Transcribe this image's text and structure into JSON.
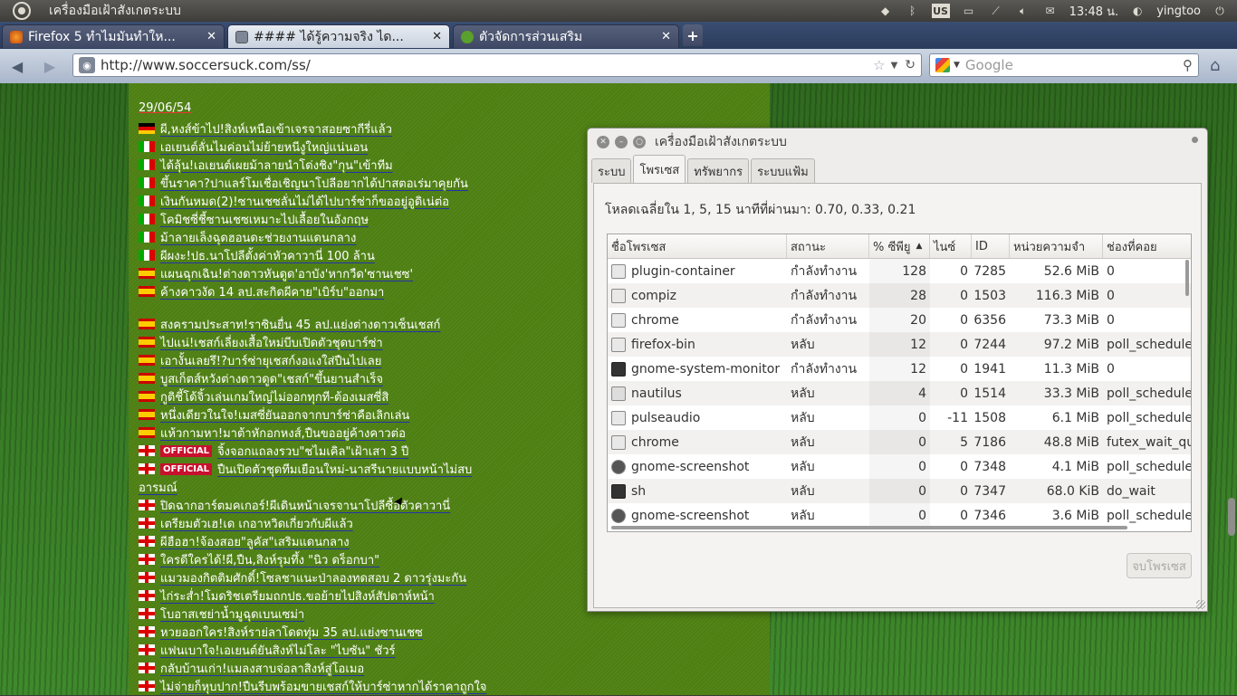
{
  "top_panel": {
    "app_title": "เครื่องมือเฝ้าสังเกตระบบ",
    "keyboard_layout": "US",
    "clock": "13:48 น.",
    "user": "yingtoo"
  },
  "tabs": [
    {
      "label": "Firefox 5 ทำไมมันทำให...",
      "icon": "firefox-icon"
    },
    {
      "label": "#### ได้รู้ความจริง ได...",
      "icon": "page-icon"
    },
    {
      "label": "ตัวจัดการส่วนเสริม",
      "icon": "puzzle-icon"
    }
  ],
  "nav": {
    "url": "http://www.soccersuck.com/ss/",
    "search_placeholder": "Google"
  },
  "news": {
    "date": "29/06/54",
    "items": [
      {
        "flag": "de",
        "text": "ผี,หงส์ข้าไป!สิงห์เหนือเข้าเจรจาสอยซากีรี่แล้ว"
      },
      {
        "flag": "it",
        "text": "เอเยนต์ลั่นไมค่อนไม่ย้ายหนีงูใหญ่แน่นอน"
      },
      {
        "flag": "it",
        "text": "ได้ลุ้น!เอเยนต์เผยม้าลายนำโด่งชิง\"กุน\"เข้าทีม"
      },
      {
        "flag": "it",
        "text": "ขึ้นราคา?ปาแลร์โมเชื่อเชิญนาโปลีอยากได้ปาสตอเร่มาคุยกัน"
      },
      {
        "flag": "it",
        "text": "เงินกันหมด(2)!ซานเชซลั่นไม่ได้ไปบาร์ซ่าก็ขออยู่อูดิเน่ต่อ"
      },
      {
        "flag": "it",
        "text": "โคมิชซี่ชี้ซานเชซเหมาะไปเลื้อยในอังกฤษ"
      },
      {
        "flag": "it",
        "text": "ม้าลายเล็งฉุดฮอนดะช่วยงานแดนกลาง"
      },
      {
        "flag": "it",
        "text": "ผีผงะ!ปธ.นาโปลีตั้งค่าหัวคาวานี่ 100 ล้าน"
      },
      {
        "flag": "es",
        "text": "แผนฉุกเฉิน!ต่างดาวหันดูด'อาบัง'หากวืด'ซานเชซ'"
      },
      {
        "flag": "es",
        "text": "ค้างคาวงัด 14 ลป.สะกิดผีคาย\"เบิร์บ\"ออกมา"
      },
      {
        "flag": "es",
        "text": "สงครามประสาท!ราซินยื่น 45 ลป.แย่งต่างดาวเซ็นเชสก์"
      },
      {
        "flag": "es",
        "text": "ไปแน่!เชสก์เลี่ยงเสื้อใหม่บีบเปิดตัวชุดบาร์ซ่า"
      },
      {
        "flag": "es",
        "text": "เอางั้นเลยรึ!?บาร์ซ่ายุเชสก์งอแงใส่ปืนไปเลย"
      },
      {
        "flag": "es",
        "text": "บูสเก็ตส์หวังต่างดาวดูด\"เชสก์\"ขึ้นยานสำเร็จ"
      },
      {
        "flag": "es",
        "text": "กูติชี้โด้จิ้วเล่นเกมใหญ่ไม่ออกทุกที-ต้องเมสซี่สิ"
      },
      {
        "flag": "es",
        "text": "หนึ่งเดียวในใจ!เมสซี่ยันออกจากบาร์ซ่าคือเลิกเล่น"
      },
      {
        "flag": "es",
        "text": "แห้วกามหา!มาต้าหักอกหงส์,ปืนขออยู่ค้างคาวต่อ"
      },
      {
        "flag": "en",
        "official": "OFFICIAL",
        "text": "จิ้งจอกแถลงรวบ\"ชไมเคิล\"เฝ้าเสา 3 ปี"
      },
      {
        "flag": "en",
        "official": "OFFICIAL",
        "text": "ปืนเปิดตัวชุดทีมเยือนใหม่-นาสรีนายแบบหน้าไม่สบ"
      },
      {
        "flag": "none",
        "text": "อารมณ์"
      },
      {
        "flag": "en",
        "text": "ปิดฉากอาร์ตมคเกอร์!ผีเดินหน้าเจรจานาโปลีซื้อตัวคาวานี่"
      },
      {
        "flag": "en",
        "text": "เตรียมตัวเฮ!เด เกอาหวิดเกี่ยวกับผีแล้ว"
      },
      {
        "flag": "en",
        "text": "ผีฮือฮา!จ้องสอย\"ลูคัส\"เสริมแดนกลาง"
      },
      {
        "flag": "en",
        "text": "ใครดีใครได้!ผี,ปืน,สิงห์รุมทึ้ง \"นิว ดร็อกบา\""
      },
      {
        "flag": "en",
        "text": "แมวมองกิตติมศักดิ์!โซลชาแนะป่าลองทดสอบ 2 ดาวรุ่งมะกัน"
      },
      {
        "flag": "en",
        "text": "ไก่ระส่ำ!โมดริชเตรียมถกปธ.ขอย้ายไปสิงห์สัปดาห์หน้า"
      },
      {
        "flag": "en",
        "text": "โบอาสเชย่าน้ำมูฉุดเบนเซม่า"
      },
      {
        "flag": "en",
        "text": "หวยออกใคร!สิงห์ราย่ลาโดดทุ่ม 35 ลป.แย่งซานเชซ"
      },
      {
        "flag": "en",
        "text": "แฟนเบาใจ!เอเยนต์ยันสิงห์ไม่โละ \"ไบซัน\" ชัวร์"
      },
      {
        "flag": "en",
        "text": "กลับบ้านเก่า!แมลงสาบจ่อลาสิงห์สู่โอเมอ"
      },
      {
        "flag": "en",
        "text": "ไม่จ่ายก็หุบปาก!ปืนรีบพร้อมขายเชสก์ให้บาร์ซ่าหากได้ราคาถูกใจ"
      }
    ]
  },
  "sysmon": {
    "title": "เครื่องมือเฝ้าสังเกตระบบ",
    "tabs": [
      "ระบบ",
      "โพรเซส",
      "ทรัพยากร",
      "ระบบแฟ้ม"
    ],
    "active_tab": "โพรเซส",
    "load_label": "โหลดเฉลี่ยใน 1, 5, 15 นาทีที่ผ่านมา: 0.70, 0.33, 0.21",
    "columns": [
      "ชื่อโพรเซส",
      "สถานะ",
      "% ซีพียู",
      "ไนซ์",
      "ID",
      "หน่วยความจำ",
      "ช่องที่คอย"
    ],
    "sort_column": "% ซีพียู",
    "processes": [
      {
        "icon": "generic",
        "name": "plugin-container",
        "status": "กำลังทำงาน",
        "cpu": "128",
        "nice": "0",
        "id": "7285",
        "mem": "52.6 MiB",
        "wait": "0"
      },
      {
        "icon": "generic",
        "name": "compiz",
        "status": "กำลังทำงาน",
        "cpu": "28",
        "nice": "0",
        "id": "1503",
        "mem": "116.3 MiB",
        "wait": "0"
      },
      {
        "icon": "generic",
        "name": "chrome",
        "status": "กำลังทำงาน",
        "cpu": "20",
        "nice": "0",
        "id": "6356",
        "mem": "73.3 MiB",
        "wait": "0"
      },
      {
        "icon": "generic",
        "name": "firefox-bin",
        "status": "หลับ",
        "cpu": "12",
        "nice": "0",
        "id": "7244",
        "mem": "97.2 MiB",
        "wait": "poll_schedule"
      },
      {
        "icon": "monitor",
        "name": "gnome-system-monitor",
        "status": "กำลังทำงาน",
        "cpu": "12",
        "nice": "0",
        "id": "1941",
        "mem": "11.3 MiB",
        "wait": "0"
      },
      {
        "icon": "folder",
        "name": "nautilus",
        "status": "หลับ",
        "cpu": "4",
        "nice": "0",
        "id": "1514",
        "mem": "33.3 MiB",
        "wait": "poll_schedule"
      },
      {
        "icon": "generic",
        "name": "pulseaudio",
        "status": "หลับ",
        "cpu": "0",
        "nice": "-11",
        "id": "1508",
        "mem": "6.1 MiB",
        "wait": "poll_schedule"
      },
      {
        "icon": "generic",
        "name": "chrome",
        "status": "หลับ",
        "cpu": "0",
        "nice": "5",
        "id": "7186",
        "mem": "48.8 MiB",
        "wait": "futex_wait_qu"
      },
      {
        "icon": "camera",
        "name": "gnome-screenshot",
        "status": "หลับ",
        "cpu": "0",
        "nice": "0",
        "id": "7348",
        "mem": "4.1 MiB",
        "wait": "poll_schedule"
      },
      {
        "icon": "term",
        "name": "sh",
        "status": "หลับ",
        "cpu": "0",
        "nice": "0",
        "id": "7347",
        "mem": "68.0 KiB",
        "wait": "do_wait"
      },
      {
        "icon": "camera",
        "name": "gnome-screenshot",
        "status": "หลับ",
        "cpu": "0",
        "nice": "0",
        "id": "7346",
        "mem": "3.6 MiB",
        "wait": "poll_schedule"
      }
    ],
    "end_process_label": "จบโพรเซส"
  }
}
